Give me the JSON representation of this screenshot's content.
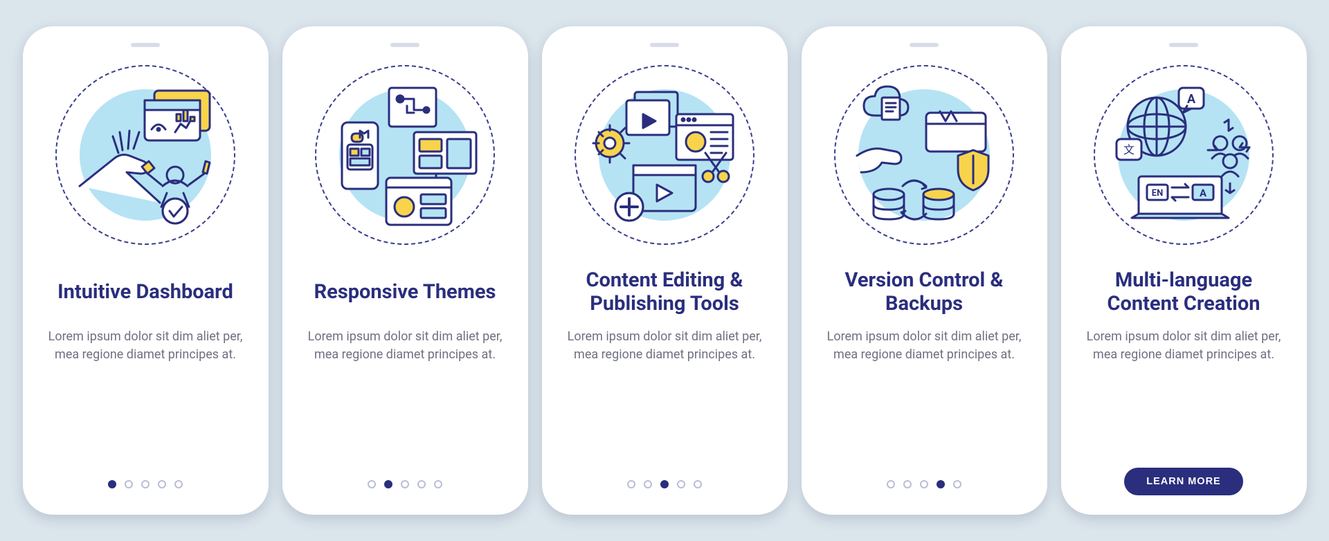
{
  "button_label": "LEARN MORE",
  "lorem": "Lorem ipsum dolor sit dim aliet per, mea regione diamet principes at.",
  "cards": [
    {
      "title": "Intuitive Dashboard"
    },
    {
      "title": "Responsive Themes"
    },
    {
      "title": "Content Editing & Publishing Tools"
    },
    {
      "title": "Version Control & Backups"
    },
    {
      "title": "Multi-language Content Creation"
    }
  ]
}
